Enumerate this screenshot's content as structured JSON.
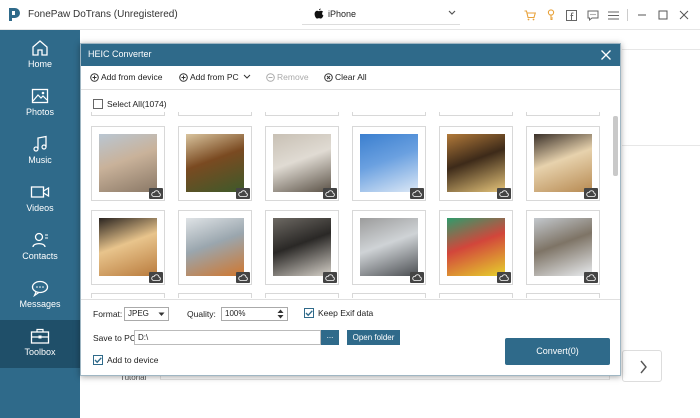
{
  "app": {
    "title": "FonePaw DoTrans (Unregistered)",
    "device": "iPhone"
  },
  "sidebar": {
    "items": [
      {
        "label": "Home"
      },
      {
        "label": "Photos"
      },
      {
        "label": "Music"
      },
      {
        "label": "Videos"
      },
      {
        "label": "Contacts"
      },
      {
        "label": "Messages"
      },
      {
        "label": "Toolbox"
      }
    ],
    "active": "Toolbox"
  },
  "background": {
    "tutorial_label": "Tutorial"
  },
  "dialog": {
    "title": "HEIC Converter",
    "toolbar": {
      "add_device": "Add from device",
      "add_pc": "Add from PC",
      "remove": "Remove",
      "clear_all": "Clear All"
    },
    "select_all": "Select All(1074)",
    "photos": [
      {
        "subject": "street",
        "colors": [
          "#b9c6d2",
          "#8a7866",
          "#c9b29a"
        ]
      },
      {
        "subject": "matcha dessert",
        "colors": [
          "#d9c49e",
          "#3d5a2a",
          "#7a4a21"
        ]
      },
      {
        "subject": "food plate",
        "colors": [
          "#c8c0b4",
          "#5b5247",
          "#e0dbd3"
        ]
      },
      {
        "subject": "sky clouds",
        "colors": [
          "#3b7fcf",
          "#dce8f6",
          "#6aa0e0"
        ]
      },
      {
        "subject": "drink",
        "colors": [
          "#b27a3a",
          "#e6c57b",
          "#3d2a19"
        ]
      },
      {
        "subject": "appetizers",
        "colors": [
          "#3a3029",
          "#b78a52",
          "#e7d2ad"
        ]
      },
      {
        "subject": "noodles",
        "colors": [
          "#2a2420",
          "#b97b3d",
          "#e8c48c"
        ]
      },
      {
        "subject": "seafood dish",
        "colors": [
          "#dfe3e6",
          "#d0772f",
          "#9aa6ae"
        ]
      },
      {
        "subject": "hallway",
        "colors": [
          "#6d6963",
          "#d5d0c8",
          "#2a2826"
        ]
      },
      {
        "subject": "car",
        "colors": [
          "#9c9c9c",
          "#4b4e52",
          "#cfd3d6"
        ]
      },
      {
        "subject": "posters",
        "colors": [
          "#2f9c6b",
          "#e6d22c",
          "#d2463b"
        ]
      },
      {
        "subject": "display case",
        "colors": [
          "#c3c8cd",
          "#e9ecef",
          "#7e7466"
        ]
      }
    ],
    "bottom": {
      "format_label": "Format:",
      "format_value": "JPEG",
      "quality_label": "Quality:",
      "quality_value": "100%",
      "keep_exif": "Keep Exif data",
      "save_label": "Save to PC:",
      "save_path": "D:\\",
      "dots": "...",
      "open_folder": "Open folder",
      "add_device": "Add to device",
      "convert": "Convert(0)"
    }
  },
  "colors": {
    "accent": "#2f6a8a",
    "accent_dark": "#1f4f69",
    "orange": "#e8a23b"
  }
}
